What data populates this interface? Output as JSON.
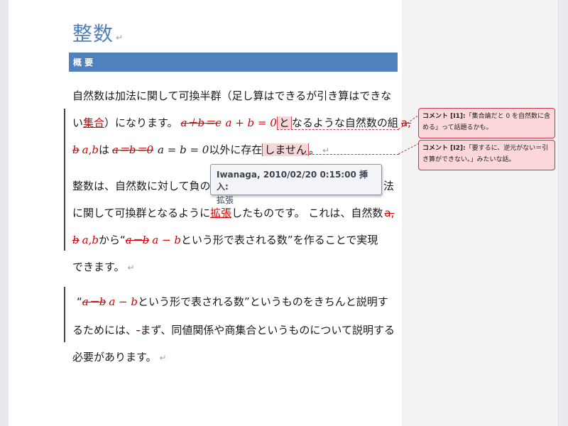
{
  "document": {
    "title": "整数",
    "paragraph_mark": "↵",
    "section_heading": "概 要",
    "lines": {
      "l1": "自然数は加法に関して可換半群（足し算はできるが引き算はできな",
      "l2_a": "い",
      "l2_ins": "集合",
      "l2_b": "）になります。",
      "l2_del1": "a＋b＝c",
      "l2_math1": "a + b = 0",
      "l2_cm": "と",
      "l2_c": "なるような自然数の組",
      "l2_del2": "a,",
      "l3_del": "b",
      "l3_math": "a,b",
      "l3_b": "は",
      "l3_del2": "a＝b＝0",
      "l3_math2": "a = b = 0",
      "l3_c": "以外に存在",
      "l3_cm": "しません",
      "l3_d": "。",
      "l4_a": "整数は、自然数に対して負の",
      "l4_b": "法",
      "l5_a": "に関して可換群となるように",
      "l5_ins": "拡張",
      "l5_b": "したものです。 これは、自然数",
      "l5_del": "a,",
      "l6_del": "b",
      "l6_math": "a,b",
      "l6_b": "から“",
      "l6_del2": "a－b",
      "l6_math2": "a − b",
      "l6_c": "という形で表される数”を作ることで実現",
      "l7": "できます。",
      "l8_a": "“",
      "l8_del": "a－b",
      "l8_math": "a − b",
      "l8_b": "という形で表される数”というものをきちんと説明す",
      "l9_a": "るためには、",
      "l9_del": "-",
      "l9_b": "まず、同値関係や商集合というものについて説明する",
      "l10": "必要があります。"
    }
  },
  "comments": [
    {
      "label": "コメント [I1]:",
      "text": "「集合論だと 0 を自然数に含める」って話題るかも。"
    },
    {
      "label": "コメント [I2]:",
      "text": "「要するに、逆元がない＝引き算ができない。」みたいな話。"
    }
  ],
  "tooltip": {
    "header": "Iwanaga, 2010/02/20 0:15:00 挿入:",
    "body": "拡張"
  },
  "colors": {
    "accent": "#4f81bd",
    "revision": "#d40000",
    "comment_fill": "#fbd7da",
    "comment_border": "#c8364a"
  }
}
